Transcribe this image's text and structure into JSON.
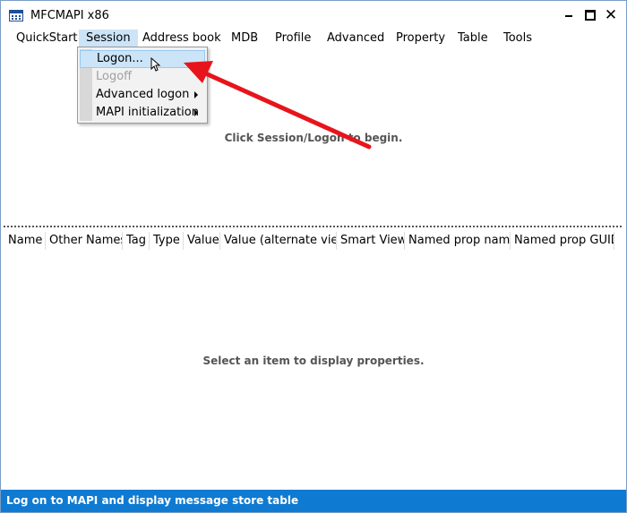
{
  "window": {
    "title": "MFCMAPI x86",
    "controls": {
      "minimize": "minimize-icon",
      "maximize": "maximize-icon",
      "close": "✕"
    }
  },
  "menubar": {
    "items": [
      {
        "label": "QuickStart"
      },
      {
        "label": "Session",
        "active": true
      },
      {
        "label": "Address book"
      },
      {
        "label": "MDB"
      },
      {
        "label": "Profile"
      },
      {
        "label": "Advanced"
      },
      {
        "label": "Property"
      },
      {
        "label": "Table"
      },
      {
        "label": "Tools"
      }
    ]
  },
  "session_menu": {
    "items": [
      {
        "label": "Logon...",
        "highlighted": true
      },
      {
        "label": "Logoff",
        "disabled": true
      },
      {
        "label": "Advanced logon",
        "submenu": true
      },
      {
        "label": "MAPI initialization",
        "submenu": true
      }
    ]
  },
  "upper_pane": {
    "message": "Click Session/Logon to begin."
  },
  "property_list": {
    "columns": [
      "Name",
      "Other Names",
      "Tag",
      "Type",
      "Value",
      "Value (alternate view)",
      "Smart View",
      "Named prop name",
      "Named prop GUID"
    ],
    "message": "Select an item to display properties."
  },
  "statusbar": {
    "text": "Log on to MAPI and display message store table"
  },
  "colors": {
    "statusbar_bg": "#0f7ad1",
    "menu_highlight": "#cce4f7",
    "annotation_arrow": "#e8141b"
  }
}
